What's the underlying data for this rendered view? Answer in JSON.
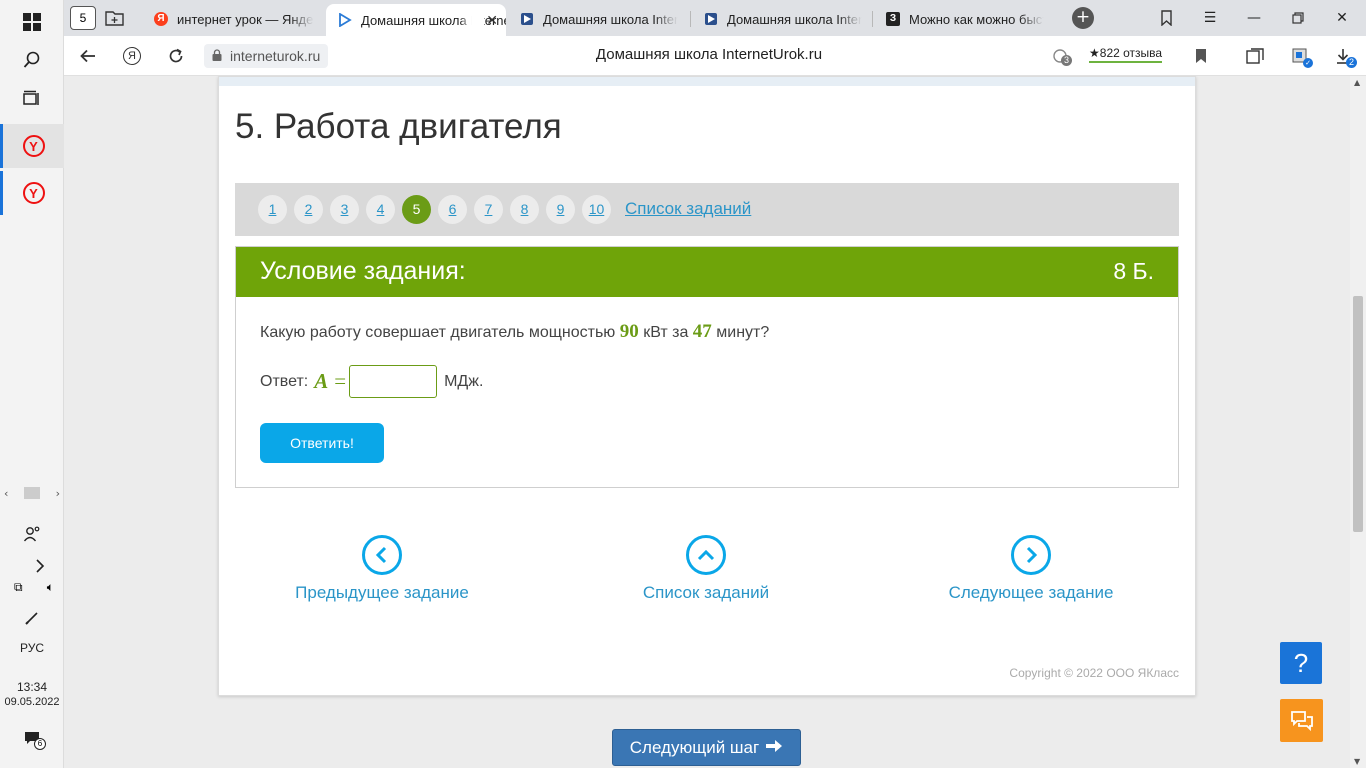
{
  "taskbar": {
    "language": "РУС",
    "time": "13:34",
    "date": "09.05.2022",
    "notifications_count": "6"
  },
  "tabs": [
    {
      "title": "интернет урок — Яндекс",
      "icon": "yandex-icon"
    },
    {
      "title": "Домашняя школа InternetUrok.ru",
      "icon": "internetUrok-icon"
    },
    {
      "title": "Домашняя школа InternetUrok.ru",
      "icon": "internetUrok-icon"
    },
    {
      "title": "Домашняя школа InternetUrok.ru",
      "icon": "internetUrok-icon"
    },
    {
      "title": "Можно как можно быстрее",
      "icon": "znanija-icon"
    }
  ],
  "browser": {
    "tab_counter": "5",
    "url": "interneturok.ru",
    "page_title": "Домашняя школа InternetUrok.ru",
    "reviews": "822 отзыва",
    "blocked_count": "3",
    "downloads_count": "2"
  },
  "lesson": {
    "title": "5. Работа двигателя"
  },
  "pager": {
    "pages": [
      "1",
      "2",
      "3",
      "4",
      "5",
      "6",
      "7",
      "8",
      "9",
      "10"
    ],
    "active": "5",
    "task_list_label": "Список заданий"
  },
  "task": {
    "header": "Условие задания:",
    "points": "8 Б.",
    "question_before": "Какую работу совершает двигатель мощностью",
    "power_value": "90",
    "question_middle": "кВт за",
    "time_value": "47",
    "question_after": "минут?",
    "answer_label": "Ответ:",
    "answer_var": "A",
    "answer_eq": "=",
    "answer_value": "",
    "answer_unit": "МДж.",
    "submit_label": "Ответить!"
  },
  "navigation": {
    "prev_label": "Предыдущее задание",
    "list_label": "Список заданий",
    "next_label": "Следующее задание"
  },
  "footer": {
    "copyright": "Copyright © 2022 ООО ЯКласс",
    "next_step_label": "Следующий шаг"
  },
  "colors": {
    "accent_green": "#6fa409",
    "link_blue": "#2b95c8",
    "button_blue": "#0aa7e8",
    "help_blue": "#1a74d8",
    "chat_orange": "#f7941e"
  }
}
